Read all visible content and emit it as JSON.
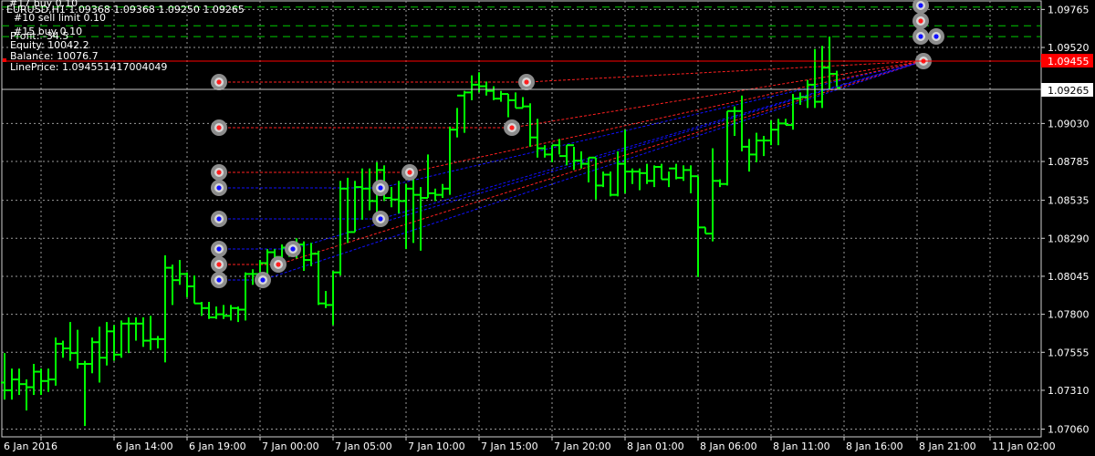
{
  "header": {
    "top_cut": "#17 buy 0.10",
    "symbol_line": "EURUSD,H1 1.09368 1.09368 1.09250 1.09265",
    "order_line": "#10 sell limit 0.10",
    "order_line2": "#15 buy 0.10",
    "profit": "Profit: -34.5",
    "equity": "Equity: 10042.2",
    "balance": "Balance: 10076.7",
    "line_price": "LinePrice: 1.094551417004049"
  },
  "colors": {
    "background": "#000000",
    "grid": "#9a9a9a",
    "candle": "#00ff00",
    "red_line": "#ff0000",
    "dashed_level": "#00cc00",
    "blue_trade": "#1010ff",
    "red_trade": "#ff2020",
    "marker_ring": "#8c8c8c",
    "price_label_bg": "#ff0000"
  },
  "chart_data": {
    "type": "candlestick",
    "symbol": "EURUSD",
    "timeframe": "H1",
    "ylim": [
      1.07,
      1.098
    ],
    "y_ticks": [
      "1.09765",
      "1.09520",
      "1.09030",
      "1.08785",
      "1.08535",
      "1.08290",
      "1.08045",
      "1.07800",
      "1.07555",
      "1.07310",
      "1.07060"
    ],
    "x_ticks": [
      "6 Jan 2016",
      "6 Jan 14:00",
      "6 Jan 19:00",
      "7 Jan 00:00",
      "7 Jan 05:00",
      "7 Jan 10:00",
      "7 Jan 15:00",
      "7 Jan 20:00",
      "8 Jan 01:00",
      "8 Jan 06:00",
      "8 Jan 11:00",
      "8 Jan 16:00",
      "8 Jan 21:00",
      "11 Jan 02:00"
    ],
    "current_price": "1.09265",
    "line_price_label": "1.09455",
    "dashed_levels": [
      1.0978,
      1.0966,
      1.0959
    ],
    "candles": [
      [
        1.0736,
        1.0755,
        1.0725,
        1.0731
      ],
      [
        1.0731,
        1.0745,
        1.0725,
        1.0738
      ],
      [
        1.0738,
        1.0745,
        1.0728,
        1.0735
      ],
      [
        1.0735,
        1.0738,
        1.0718,
        1.0733
      ],
      [
        1.0733,
        1.0748,
        1.0728,
        1.0743
      ],
      [
        1.0743,
        1.0745,
        1.0728,
        1.0737
      ],
      [
        1.0737,
        1.0745,
        1.073,
        1.0738
      ],
      [
        1.0738,
        1.0765,
        1.0734,
        1.0761
      ],
      [
        1.0761,
        1.0763,
        1.0752,
        1.0758
      ],
      [
        1.0758,
        1.0775,
        1.075,
        1.0755
      ],
      [
        1.0755,
        1.077,
        1.0745,
        1.0748
      ],
      [
        1.0748,
        1.075,
        1.0708,
        1.0748
      ],
      [
        1.0748,
        1.0765,
        1.0742,
        1.0762
      ],
      [
        1.0762,
        1.0772,
        1.0736,
        1.0752
      ],
      [
        1.0752,
        1.0775,
        1.0747,
        1.0769
      ],
      [
        1.0769,
        1.0773,
        1.075,
        1.0754
      ],
      [
        1.0754,
        1.0776,
        1.0752,
        1.0774
      ],
      [
        1.0774,
        1.0778,
        1.0755,
        1.0774
      ],
      [
        1.0774,
        1.0778,
        1.0763,
        1.0774
      ],
      [
        1.0774,
        1.0778,
        1.0759,
        1.0763
      ],
      [
        1.0763,
        1.0779,
        1.0757,
        1.0764
      ],
      [
        1.0764,
        1.0766,
        1.0758,
        1.0764
      ],
      [
        1.0764,
        1.0818,
        1.0749,
        1.081
      ],
      [
        1.081,
        1.0812,
        1.0786,
        1.0802
      ],
      [
        1.0802,
        1.0815,
        1.0799,
        1.0806
      ],
      [
        1.0806,
        1.0807,
        1.0791,
        1.0798
      ],
      [
        1.0798,
        1.0805,
        1.0787,
        1.0787
      ],
      [
        1.0787,
        1.0788,
        1.0779,
        1.0784
      ],
      [
        1.0784,
        1.0788,
        1.0777,
        1.0778
      ],
      [
        1.0778,
        1.0785,
        1.0777,
        1.078
      ],
      [
        1.078,
        1.0786,
        1.0777,
        1.0779
      ],
      [
        1.0779,
        1.0786,
        1.0776,
        1.0784
      ],
      [
        1.0784,
        1.0785,
        1.0775,
        1.0783
      ],
      [
        1.0783,
        1.0807,
        1.0776,
        1.0806
      ],
      [
        1.0806,
        1.0809,
        1.0799,
        1.0806
      ],
      [
        1.0806,
        1.0815,
        1.0801,
        1.0813
      ],
      [
        1.0813,
        1.0822,
        1.0806,
        1.082
      ],
      [
        1.082,
        1.0822,
        1.0813,
        1.0817
      ],
      [
        1.0817,
        1.0825,
        1.0815,
        1.0823
      ],
      [
        1.0823,
        1.0825,
        1.0817,
        1.0823
      ],
      [
        1.0823,
        1.0829,
        1.0816,
        1.0825
      ],
      [
        1.0825,
        1.0827,
        1.0808,
        1.0815
      ],
      [
        1.0815,
        1.0826,
        1.0811,
        1.0819
      ],
      [
        1.0819,
        1.0821,
        1.0786,
        1.0787
      ],
      [
        1.0787,
        1.0795,
        1.0784,
        1.0786
      ],
      [
        1.0786,
        1.0808,
        1.0773,
        1.0807
      ],
      [
        1.0807,
        1.0866,
        1.0805,
        1.0861
      ],
      [
        1.0861,
        1.0868,
        1.0826,
        1.0833
      ],
      [
        1.0833,
        1.0866,
        1.0833,
        1.0862
      ],
      [
        1.0862,
        1.0874,
        1.0841,
        1.0861
      ],
      [
        1.0861,
        1.0874,
        1.0847,
        1.0853
      ],
      [
        1.0853,
        1.0878,
        1.0845,
        1.0873
      ],
      [
        1.0873,
        1.0876,
        1.0853,
        1.0855
      ],
      [
        1.0855,
        1.0862,
        1.0849,
        1.0854
      ],
      [
        1.0854,
        1.0866,
        1.0845,
        1.0853
      ],
      [
        1.0853,
        1.0864,
        1.0822,
        1.0861
      ],
      [
        1.0861,
        1.0871,
        1.0826,
        1.0857
      ],
      [
        1.0857,
        1.0862,
        1.0821,
        1.0855
      ],
      [
        1.0855,
        1.0883,
        1.0855,
        1.0858
      ],
      [
        1.0858,
        1.0861,
        1.0853,
        1.0857
      ],
      [
        1.0857,
        1.0864,
        1.0855,
        1.0861
      ],
      [
        1.0861,
        1.0901,
        1.0857,
        1.0899
      ],
      [
        1.0899,
        1.0913,
        1.0894,
        1.0921
      ],
      [
        1.0921,
        1.0924,
        1.0897,
        1.0923
      ],
      [
        1.0923,
        1.0934,
        1.0918,
        1.0928
      ],
      [
        1.0928,
        1.0936,
        1.0923,
        1.0927
      ],
      [
        1.0927,
        1.093,
        1.0921,
        1.0924
      ],
      [
        1.0924,
        1.0927,
        1.0918,
        1.0919
      ],
      [
        1.0919,
        1.0924,
        1.0917,
        1.0922
      ],
      [
        1.0922,
        1.0922,
        1.0907,
        1.0918
      ],
      [
        1.0918,
        1.0923,
        1.0913,
        1.0913
      ],
      [
        1.0913,
        1.092,
        1.0913,
        1.0914
      ],
      [
        1.0914,
        1.0916,
        1.0888,
        1.0894
      ],
      [
        1.0894,
        1.0906,
        1.0881,
        1.0887
      ],
      [
        1.0887,
        1.0889,
        1.0881,
        1.0883
      ],
      [
        1.0883,
        1.0889,
        1.0878,
        1.0889
      ],
      [
        1.0889,
        1.0893,
        1.0883,
        1.0882
      ],
      [
        1.0882,
        1.0889,
        1.0876,
        1.0889
      ],
      [
        1.0889,
        1.0888,
        1.0873,
        1.0879
      ],
      [
        1.0879,
        1.0885,
        1.0874,
        1.0877
      ],
      [
        1.0877,
        1.0881,
        1.0865,
        1.0881
      ],
      [
        1.0881,
        1.0881,
        1.0854,
        1.0863
      ],
      [
        1.0863,
        1.0872,
        1.0862,
        1.087
      ],
      [
        1.087,
        1.0872,
        1.0856,
        1.0857
      ],
      [
        1.0857,
        1.0885,
        1.0856,
        1.0877
      ],
      [
        1.0877,
        1.0899,
        1.0858,
        1.0872
      ],
      [
        1.0872,
        1.0874,
        1.0864,
        1.0872
      ],
      [
        1.0872,
        1.0874,
        1.086,
        1.0871
      ],
      [
        1.0871,
        1.0877,
        1.0864,
        1.0866
      ],
      [
        1.0866,
        1.0876,
        1.0862,
        1.0875
      ],
      [
        1.0875,
        1.0877,
        1.0867,
        1.0867
      ],
      [
        1.0867,
        1.0872,
        1.0862,
        1.0874
      ],
      [
        1.0874,
        1.0877,
        1.0867,
        1.0868
      ],
      [
        1.0868,
        1.0876,
        1.0866,
        1.0873
      ],
      [
        1.0873,
        1.0876,
        1.0858,
        1.0869
      ],
      [
        1.0869,
        1.0869,
        1.0804,
        1.0836
      ],
      [
        1.0836,
        1.0836,
        1.0832,
        1.0832
      ],
      [
        1.0832,
        1.0887,
        1.0827,
        1.0866
      ],
      [
        1.0866,
        1.0867,
        1.0862,
        1.0864
      ],
      [
        1.0864,
        1.0911,
        1.0863,
        1.0911
      ],
      [
        1.0911,
        1.0914,
        1.0895,
        1.0911
      ],
      [
        1.0911,
        1.0921,
        1.0885,
        1.0888
      ],
      [
        1.0888,
        1.0893,
        1.0872,
        1.0883
      ],
      [
        1.0883,
        1.0897,
        1.0878,
        1.0892
      ],
      [
        1.0892,
        1.0895,
        1.0882,
        1.0892
      ],
      [
        1.0892,
        1.0905,
        1.0889,
        1.0899
      ],
      [
        1.0899,
        1.0906,
        1.0889,
        1.0903
      ],
      [
        1.0903,
        1.0906,
        1.0902,
        1.0902
      ],
      [
        1.0902,
        1.0922,
        1.0899,
        1.0919
      ],
      [
        1.0919,
        1.0923,
        1.0915,
        1.092
      ],
      [
        1.092,
        1.0931,
        1.0913,
        1.0928
      ],
      [
        1.0928,
        1.0951,
        1.0913,
        1.0917
      ],
      [
        1.0917,
        1.0953,
        1.0913,
        1.0939
      ],
      [
        1.0939,
        1.0959,
        1.0925,
        1.0935
      ],
      [
        1.0935,
        1.0937,
        1.0927,
        1.0926
      ]
    ],
    "trade_markers": [
      {
        "color": "red",
        "x": 1.07,
        "price": 1.0935
      },
      {
        "color": "red",
        "x": 1.07,
        "price": 1.0905
      },
      {
        "color": "red",
        "x": 1.07,
        "price": 1.0875
      },
      {
        "color": "blue",
        "x": 1.07,
        "price": 1.0865
      },
      {
        "color": "blue",
        "x": 1.07,
        "price": 1.0845
      },
      {
        "color": "blue",
        "x": 1.07,
        "price": 1.0825
      },
      {
        "color": "red",
        "x": 1.07,
        "price": 1.0815
      },
      {
        "color": "blue",
        "x": 1.07,
        "price": 1.0805
      },
      {
        "color": "blue",
        "x": 1.075,
        "price": 1.0805
      },
      {
        "color": "red",
        "x": 1.077,
        "price": 1.0815
      },
      {
        "color": "blue",
        "x": 1.079,
        "price": 1.0825
      },
      {
        "color": "blue",
        "x": 1.09,
        "price": 1.0865
      },
      {
        "color": "blue",
        "x": 1.09,
        "price": 1.0845
      },
      {
        "color": "red",
        "x": 1.092,
        "price": 1.0875
      },
      {
        "color": "red",
        "x": 1.1,
        "price": 1.0905
      },
      {
        "color": "red",
        "x": 1.101,
        "price": 1.0935
      },
      {
        "color": "red",
        "x": 1.129,
        "price": 1.0955
      },
      {
        "color": "blue",
        "x": 1.13,
        "price": 1.0965
      },
      {
        "color": "blue",
        "x": 1.129,
        "price": 1.0965
      },
      {
        "color": "red",
        "x": 1.129,
        "price": 1.0975
      },
      {
        "color": "blue",
        "x": 1.129,
        "price": 1.0985
      }
    ]
  }
}
